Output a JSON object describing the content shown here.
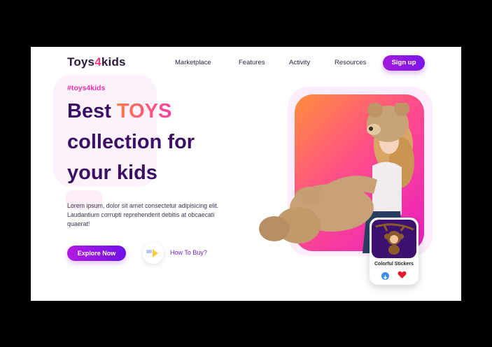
{
  "brand": {
    "prefix": "Toys",
    "four": "4",
    "suffix": "kids"
  },
  "nav": {
    "items": [
      "Marketplace",
      "Features",
      "Activity",
      "Resources"
    ],
    "signup": "Sign up"
  },
  "hero": {
    "tag": "#toys4kids",
    "headline_part1": "Best ",
    "headline_highlight": "TOYS",
    "headline_line2": "collection for",
    "headline_line3": "your kids",
    "paragraph": "Lorem ipsum, dolor sit amet consectetur adipisicing elit. Laudantium corrupti reprehenderit debitis at obcaecati quaerat!",
    "explore_label": "Explore Now",
    "howbuy_label": "How To Buy?"
  },
  "card": {
    "label": "Colorful Stickers"
  },
  "colors": {
    "accent": "#7b16e8",
    "pink": "#ff3fa0",
    "heading": "#3b1064"
  }
}
